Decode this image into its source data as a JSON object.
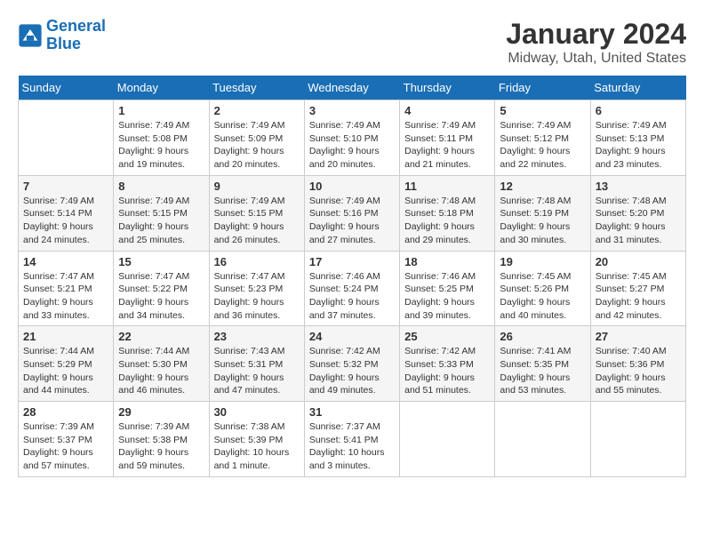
{
  "header": {
    "logo_line1": "General",
    "logo_line2": "Blue",
    "main_title": "January 2024",
    "sub_title": "Midway, Utah, United States"
  },
  "days_of_week": [
    "Sunday",
    "Monday",
    "Tuesday",
    "Wednesday",
    "Thursday",
    "Friday",
    "Saturday"
  ],
  "weeks": [
    [
      {
        "num": "",
        "info": ""
      },
      {
        "num": "1",
        "info": "Sunrise: 7:49 AM\nSunset: 5:08 PM\nDaylight: 9 hours\nand 19 minutes."
      },
      {
        "num": "2",
        "info": "Sunrise: 7:49 AM\nSunset: 5:09 PM\nDaylight: 9 hours\nand 20 minutes."
      },
      {
        "num": "3",
        "info": "Sunrise: 7:49 AM\nSunset: 5:10 PM\nDaylight: 9 hours\nand 20 minutes."
      },
      {
        "num": "4",
        "info": "Sunrise: 7:49 AM\nSunset: 5:11 PM\nDaylight: 9 hours\nand 21 minutes."
      },
      {
        "num": "5",
        "info": "Sunrise: 7:49 AM\nSunset: 5:12 PM\nDaylight: 9 hours\nand 22 minutes."
      },
      {
        "num": "6",
        "info": "Sunrise: 7:49 AM\nSunset: 5:13 PM\nDaylight: 9 hours\nand 23 minutes."
      }
    ],
    [
      {
        "num": "7",
        "info": "Sunrise: 7:49 AM\nSunset: 5:14 PM\nDaylight: 9 hours\nand 24 minutes."
      },
      {
        "num": "8",
        "info": "Sunrise: 7:49 AM\nSunset: 5:15 PM\nDaylight: 9 hours\nand 25 minutes."
      },
      {
        "num": "9",
        "info": "Sunrise: 7:49 AM\nSunset: 5:15 PM\nDaylight: 9 hours\nand 26 minutes."
      },
      {
        "num": "10",
        "info": "Sunrise: 7:49 AM\nSunset: 5:16 PM\nDaylight: 9 hours\nand 27 minutes."
      },
      {
        "num": "11",
        "info": "Sunrise: 7:48 AM\nSunset: 5:18 PM\nDaylight: 9 hours\nand 29 minutes."
      },
      {
        "num": "12",
        "info": "Sunrise: 7:48 AM\nSunset: 5:19 PM\nDaylight: 9 hours\nand 30 minutes."
      },
      {
        "num": "13",
        "info": "Sunrise: 7:48 AM\nSunset: 5:20 PM\nDaylight: 9 hours\nand 31 minutes."
      }
    ],
    [
      {
        "num": "14",
        "info": "Sunrise: 7:47 AM\nSunset: 5:21 PM\nDaylight: 9 hours\nand 33 minutes."
      },
      {
        "num": "15",
        "info": "Sunrise: 7:47 AM\nSunset: 5:22 PM\nDaylight: 9 hours\nand 34 minutes."
      },
      {
        "num": "16",
        "info": "Sunrise: 7:47 AM\nSunset: 5:23 PM\nDaylight: 9 hours\nand 36 minutes."
      },
      {
        "num": "17",
        "info": "Sunrise: 7:46 AM\nSunset: 5:24 PM\nDaylight: 9 hours\nand 37 minutes."
      },
      {
        "num": "18",
        "info": "Sunrise: 7:46 AM\nSunset: 5:25 PM\nDaylight: 9 hours\nand 39 minutes."
      },
      {
        "num": "19",
        "info": "Sunrise: 7:45 AM\nSunset: 5:26 PM\nDaylight: 9 hours\nand 40 minutes."
      },
      {
        "num": "20",
        "info": "Sunrise: 7:45 AM\nSunset: 5:27 PM\nDaylight: 9 hours\nand 42 minutes."
      }
    ],
    [
      {
        "num": "21",
        "info": "Sunrise: 7:44 AM\nSunset: 5:29 PM\nDaylight: 9 hours\nand 44 minutes."
      },
      {
        "num": "22",
        "info": "Sunrise: 7:44 AM\nSunset: 5:30 PM\nDaylight: 9 hours\nand 46 minutes."
      },
      {
        "num": "23",
        "info": "Sunrise: 7:43 AM\nSunset: 5:31 PM\nDaylight: 9 hours\nand 47 minutes."
      },
      {
        "num": "24",
        "info": "Sunrise: 7:42 AM\nSunset: 5:32 PM\nDaylight: 9 hours\nand 49 minutes."
      },
      {
        "num": "25",
        "info": "Sunrise: 7:42 AM\nSunset: 5:33 PM\nDaylight: 9 hours\nand 51 minutes."
      },
      {
        "num": "26",
        "info": "Sunrise: 7:41 AM\nSunset: 5:35 PM\nDaylight: 9 hours\nand 53 minutes."
      },
      {
        "num": "27",
        "info": "Sunrise: 7:40 AM\nSunset: 5:36 PM\nDaylight: 9 hours\nand 55 minutes."
      }
    ],
    [
      {
        "num": "28",
        "info": "Sunrise: 7:39 AM\nSunset: 5:37 PM\nDaylight: 9 hours\nand 57 minutes."
      },
      {
        "num": "29",
        "info": "Sunrise: 7:39 AM\nSunset: 5:38 PM\nDaylight: 9 hours\nand 59 minutes."
      },
      {
        "num": "30",
        "info": "Sunrise: 7:38 AM\nSunset: 5:39 PM\nDaylight: 10 hours\nand 1 minute."
      },
      {
        "num": "31",
        "info": "Sunrise: 7:37 AM\nSunset: 5:41 PM\nDaylight: 10 hours\nand 3 minutes."
      },
      {
        "num": "",
        "info": ""
      },
      {
        "num": "",
        "info": ""
      },
      {
        "num": "",
        "info": ""
      }
    ]
  ]
}
